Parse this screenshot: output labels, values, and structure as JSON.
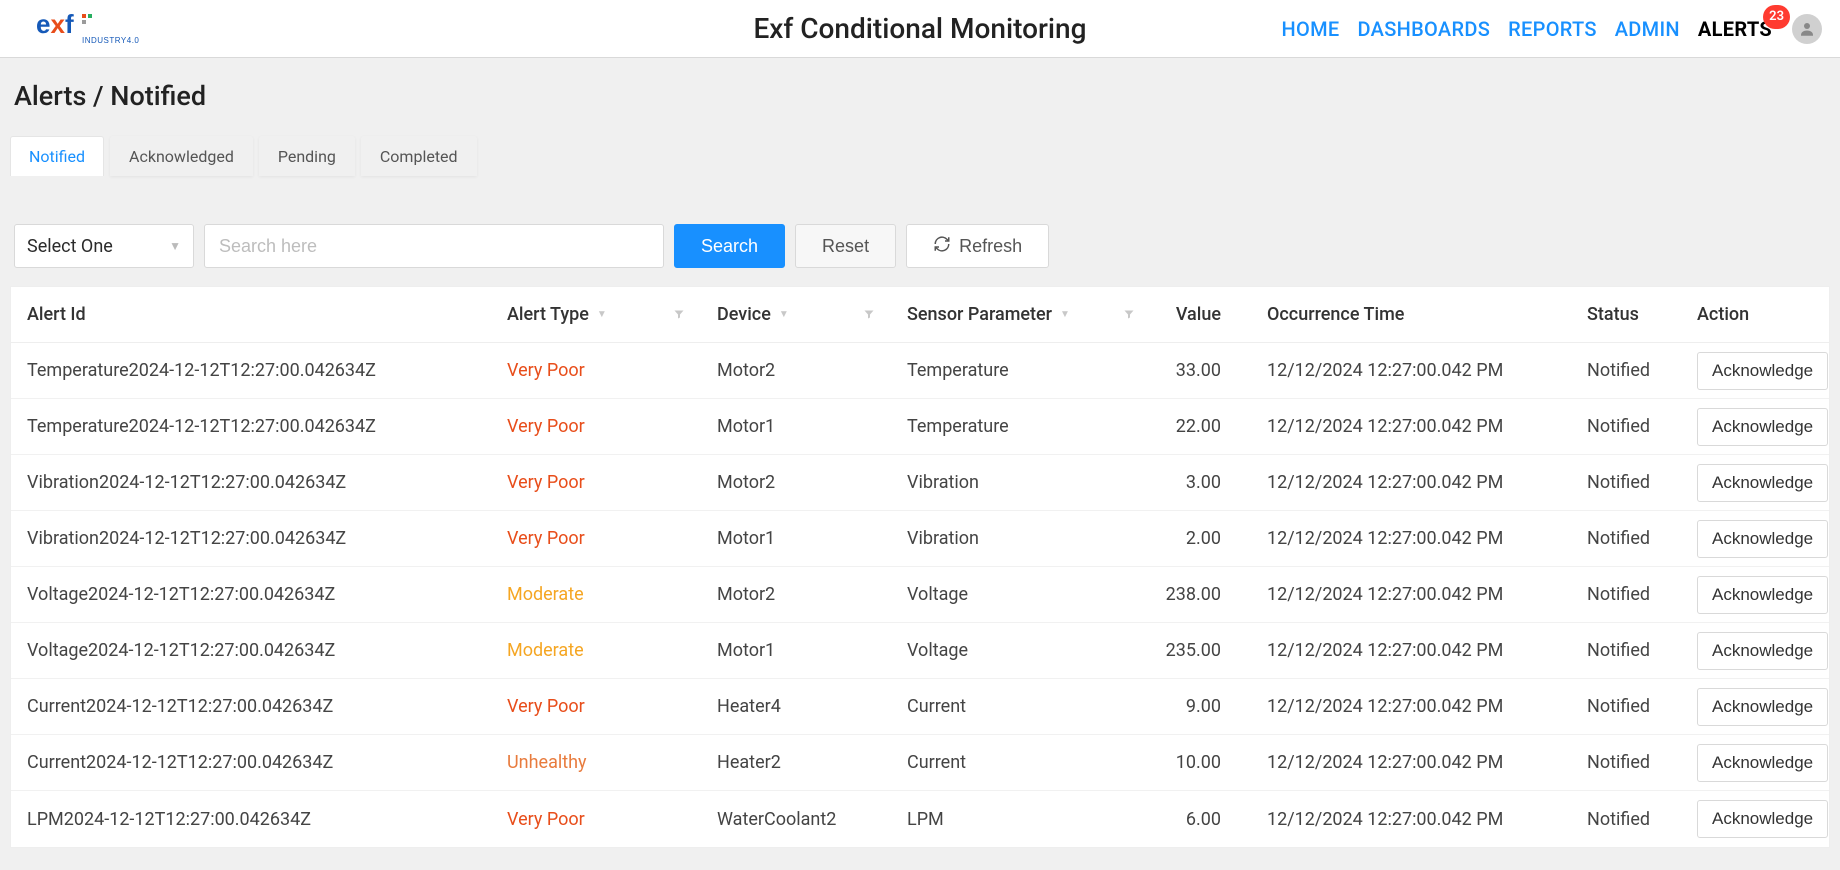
{
  "header": {
    "app_title": "Exf Conditional Monitoring",
    "logo": {
      "brand": "exf",
      "subtext": "INDUSTRY4.0"
    },
    "nav": [
      {
        "label": "HOME",
        "active": false
      },
      {
        "label": "DASHBOARDS",
        "active": false
      },
      {
        "label": "REPORTS",
        "active": false
      },
      {
        "label": "ADMIN",
        "active": false
      },
      {
        "label": "ALERTS",
        "active": true,
        "badge": "23"
      }
    ]
  },
  "breadcrumb": "Alerts / Notified",
  "tabs": [
    {
      "label": "Notified",
      "active": true
    },
    {
      "label": "Acknowledged",
      "active": false
    },
    {
      "label": "Pending",
      "active": false
    },
    {
      "label": "Completed",
      "active": false
    }
  ],
  "toolbar": {
    "select_placeholder": "Select One",
    "search_placeholder": "Search here",
    "search_btn": "Search",
    "reset_btn": "Reset",
    "refresh_btn": "Refresh"
  },
  "table": {
    "columns": [
      {
        "label": "Alert Id"
      },
      {
        "label": "Alert Type",
        "sortable": true,
        "filter": true
      },
      {
        "label": "Device",
        "sortable": true,
        "filter": true
      },
      {
        "label": "Sensor Parameter",
        "sortable": true,
        "filter": true
      },
      {
        "label": "Value"
      },
      {
        "label": "Occurrence Time"
      },
      {
        "label": "Status"
      },
      {
        "label": "Action"
      }
    ],
    "action_label": "Acknowledge",
    "rows": [
      {
        "alert_id": "Temperature2024-12-12T12:27:00.042634Z",
        "alert_type": "Very Poor",
        "type_class": "very-poor",
        "device": "Motor2",
        "sensor": "Temperature",
        "value": "33.00",
        "time": "12/12/2024 12:27:00.042 PM",
        "status": "Notified"
      },
      {
        "alert_id": "Temperature2024-12-12T12:27:00.042634Z",
        "alert_type": "Very Poor",
        "type_class": "very-poor",
        "device": "Motor1",
        "sensor": "Temperature",
        "value": "22.00",
        "time": "12/12/2024 12:27:00.042 PM",
        "status": "Notified"
      },
      {
        "alert_id": "Vibration2024-12-12T12:27:00.042634Z",
        "alert_type": "Very Poor",
        "type_class": "very-poor",
        "device": "Motor2",
        "sensor": "Vibration",
        "value": "3.00",
        "time": "12/12/2024 12:27:00.042 PM",
        "status": "Notified"
      },
      {
        "alert_id": "Vibration2024-12-12T12:27:00.042634Z",
        "alert_type": "Very Poor",
        "type_class": "very-poor",
        "device": "Motor1",
        "sensor": "Vibration",
        "value": "2.00",
        "time": "12/12/2024 12:27:00.042 PM",
        "status": "Notified"
      },
      {
        "alert_id": "Voltage2024-12-12T12:27:00.042634Z",
        "alert_type": "Moderate",
        "type_class": "moderate",
        "device": "Motor2",
        "sensor": "Voltage",
        "value": "238.00",
        "time": "12/12/2024 12:27:00.042 PM",
        "status": "Notified"
      },
      {
        "alert_id": "Voltage2024-12-12T12:27:00.042634Z",
        "alert_type": "Moderate",
        "type_class": "moderate",
        "device": "Motor1",
        "sensor": "Voltage",
        "value": "235.00",
        "time": "12/12/2024 12:27:00.042 PM",
        "status": "Notified"
      },
      {
        "alert_id": "Current2024-12-12T12:27:00.042634Z",
        "alert_type": "Very Poor",
        "type_class": "very-poor",
        "device": "Heater4",
        "sensor": "Current",
        "value": "9.00",
        "time": "12/12/2024 12:27:00.042 PM",
        "status": "Notified"
      },
      {
        "alert_id": "Current2024-12-12T12:27:00.042634Z",
        "alert_type": "Unhealthy",
        "type_class": "unhealthy",
        "device": "Heater2",
        "sensor": "Current",
        "value": "10.00",
        "time": "12/12/2024 12:27:00.042 PM",
        "status": "Notified"
      },
      {
        "alert_id": "LPM2024-12-12T12:27:00.042634Z",
        "alert_type": "Very Poor",
        "type_class": "very-poor",
        "device": "WaterCoolant2",
        "sensor": "LPM",
        "value": "6.00",
        "time": "12/12/2024 12:27:00.042 PM",
        "status": "Notified"
      }
    ]
  }
}
